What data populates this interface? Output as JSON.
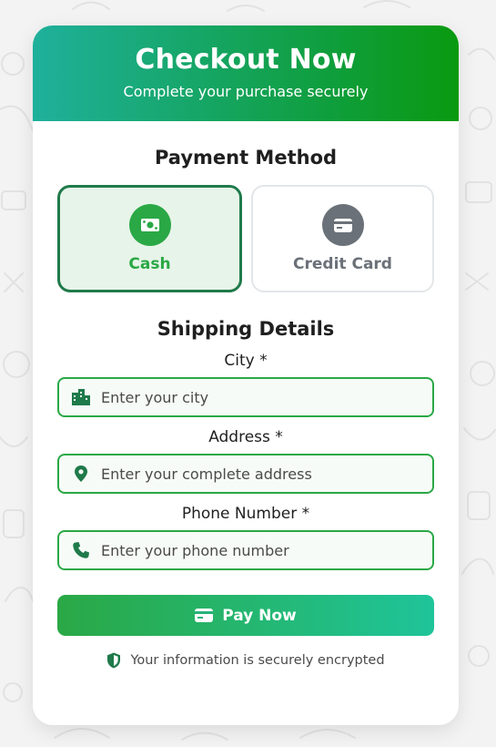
{
  "header": {
    "title": "Checkout Now",
    "subtitle": "Complete your purchase securely"
  },
  "payment": {
    "title": "Payment Method",
    "methods": [
      {
        "label": "Cash",
        "icon": "money-bill-icon",
        "selected": true
      },
      {
        "label": "Credit Card",
        "icon": "credit-card-icon",
        "selected": false
      }
    ]
  },
  "shipping": {
    "title": "Shipping Details",
    "fields": [
      {
        "label": "City *",
        "placeholder": "Enter your city",
        "value": "",
        "icon": "city-icon"
      },
      {
        "label": "Address *",
        "placeholder": "Enter your complete address",
        "value": "",
        "icon": "map-pin-icon"
      },
      {
        "label": "Phone Number *",
        "placeholder": "Enter your phone number",
        "value": "",
        "icon": "phone-icon"
      }
    ]
  },
  "pay_button": {
    "label": "Pay Now",
    "icon": "credit-card-icon"
  },
  "security_note": {
    "text": "Your information is securely encrypted",
    "icon": "shield-icon"
  },
  "colors": {
    "primary_green": "#2aa845",
    "dark_green": "#1f7a4a",
    "gradient_start": "#1fb09c",
    "gradient_end": "#0a9a10",
    "muted_gray": "#6b7178"
  }
}
